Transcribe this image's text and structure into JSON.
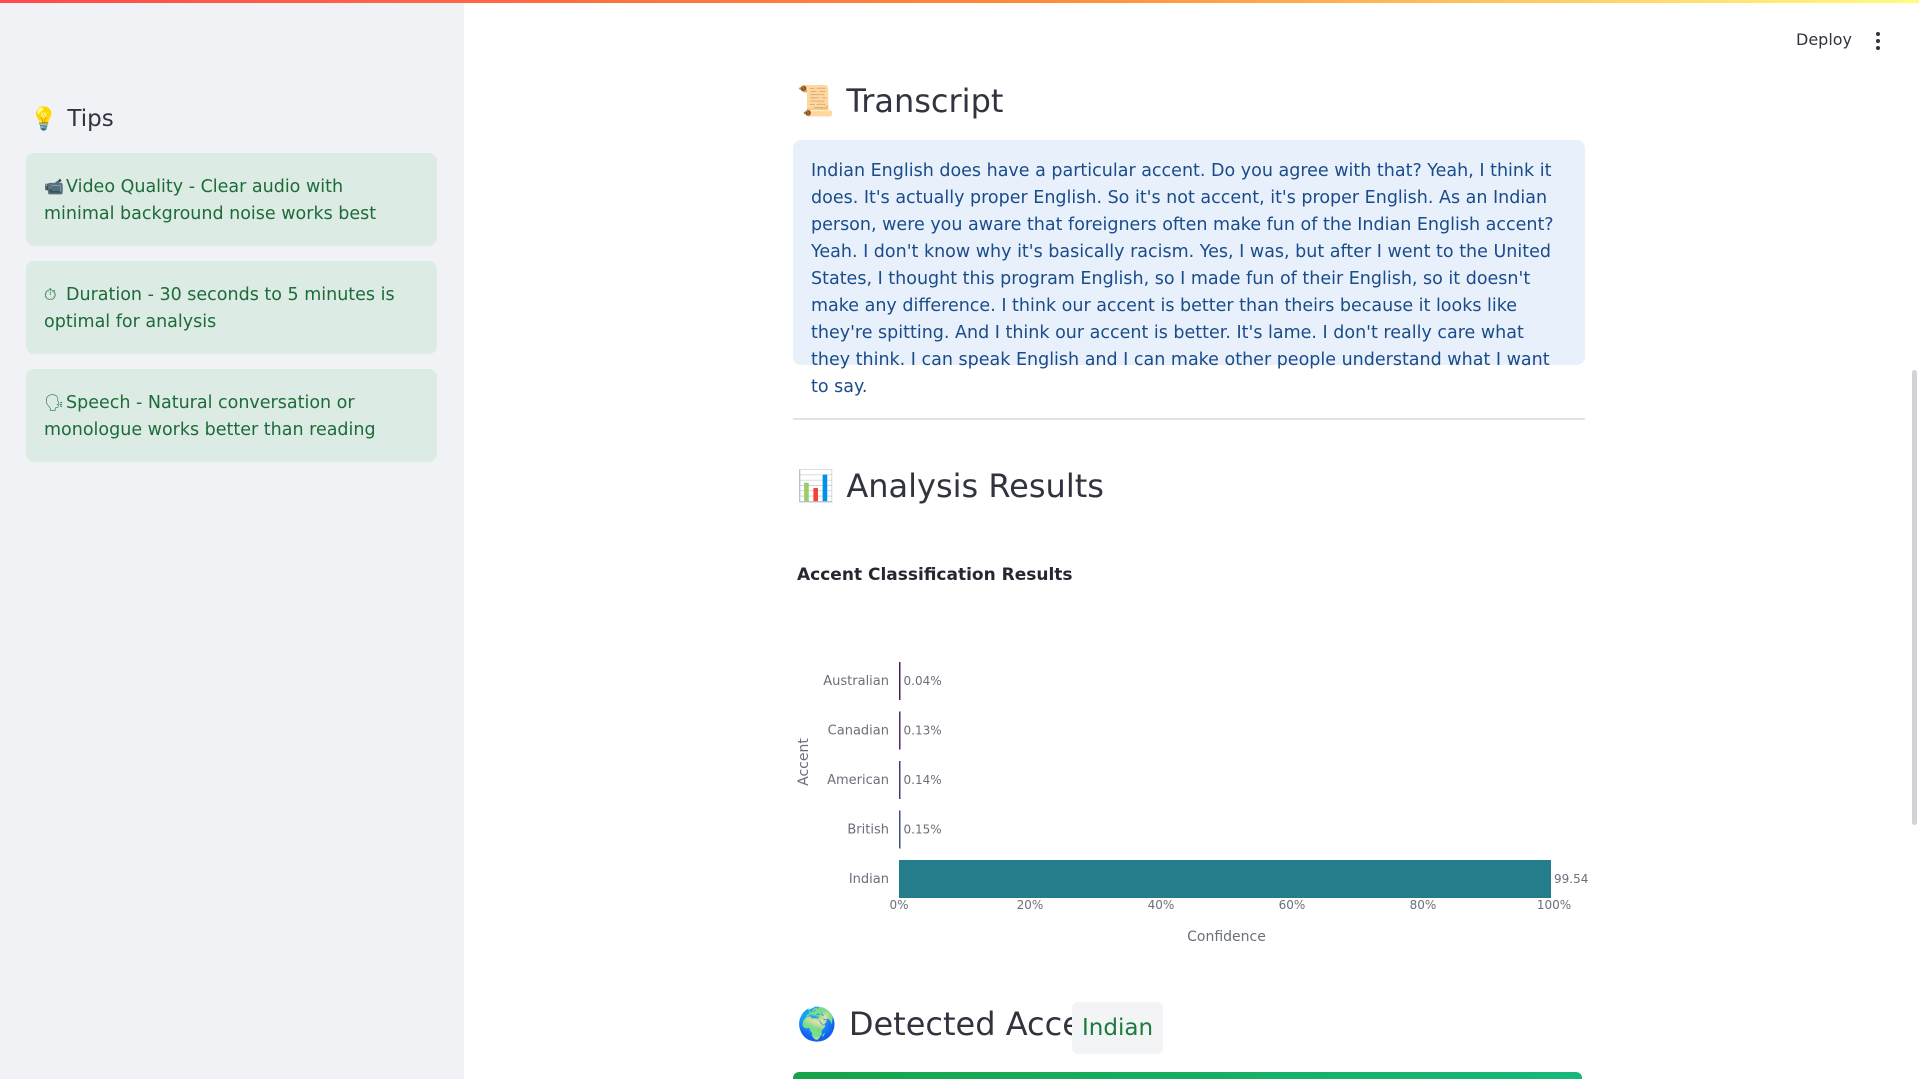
{
  "header": {
    "deploy_label": "Deploy",
    "menu_icon": "kebab-menu-icon"
  },
  "sidebar": {
    "tips_icon": "💡",
    "tips_title": "Tips",
    "tips": [
      {
        "icon": "📹",
        "text": "Video Quality - Clear audio with minimal background noise works best"
      },
      {
        "icon": "⏱",
        "text": "Duration - 30 seconds to 5 minutes is optimal for analysis"
      },
      {
        "icon": "🗣",
        "text": "Speech - Natural conversation or monologue works better than reading"
      }
    ]
  },
  "transcript": {
    "icon": "📜",
    "title": "Transcript",
    "text": "Indian English does have a particular accent. Do you agree with that? Yeah, I think it does. It's actually proper English. So it's not accent, it's proper English. As an Indian person, were you aware that foreigners often make fun of the Indian English accent? Yeah. I don't know why it's basically racism. Yes, I was, but after I went to the United States, I thought this program English, so I made fun of their English, so it doesn't make any difference. I think our accent is better than theirs because it looks like they're spitting. And I think our accent is better. It's lame. I don't really care what they think. I can speak English and I can make other people understand what I want to say."
  },
  "analysis": {
    "icon": "📊",
    "title": "Analysis Results"
  },
  "chart_data": {
    "type": "bar",
    "orientation": "horizontal",
    "title": "Accent Classification Results",
    "xlabel": "Confidence",
    "ylabel": "Accent",
    "categories": [
      "Australian",
      "Canadian",
      "American",
      "British",
      "Indian"
    ],
    "values": [
      0.04,
      0.13,
      0.14,
      0.15,
      99.54
    ],
    "data_labels": [
      "0.04%",
      "0.13%",
      "0.14%",
      "0.15%",
      "99.54"
    ],
    "colors": [
      "#4b1d5c",
      "#4b2a6e",
      "#3e3d7a",
      "#37508a",
      "#257d8c"
    ],
    "xlim": [
      0,
      100
    ],
    "x_ticks": [
      0,
      20,
      40,
      60,
      80,
      100
    ],
    "x_tick_labels": [
      "0%",
      "20%",
      "40%",
      "60%",
      "80%",
      "100%"
    ],
    "grid": false,
    "legend": "none"
  },
  "detected": {
    "icon": "🌍",
    "label": "Detected Accent:",
    "value": "Indian"
  },
  "colors": {
    "accent_green": "#1d7a3e",
    "tip_bg": "#dcebe3",
    "transcript_bg": "#e8f1fb"
  }
}
